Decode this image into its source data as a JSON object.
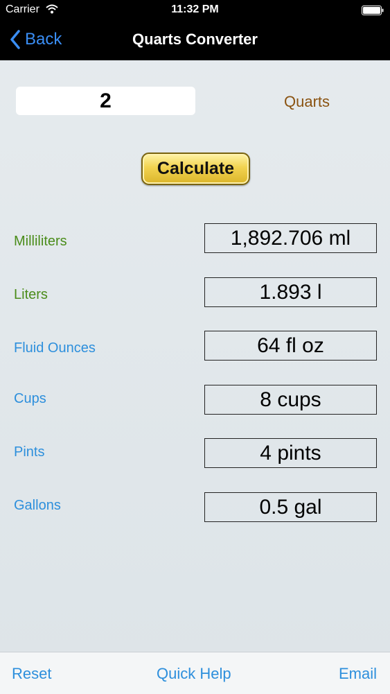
{
  "status_bar": {
    "carrier": "Carrier",
    "time": "11:32 PM"
  },
  "nav": {
    "back_label": "Back",
    "title": "Quarts Converter"
  },
  "input": {
    "value": "2",
    "unit": "Quarts"
  },
  "calculate_label": "Calculate",
  "results": [
    {
      "label": "Milliliters",
      "value": "1,892.706 ml"
    },
    {
      "label": "Liters",
      "value": "1.893 l"
    },
    {
      "label": "Fluid Ounces",
      "value": "64 fl oz"
    },
    {
      "label": "Cups",
      "value": "8 cups"
    },
    {
      "label": "Pints",
      "value": "4 pints"
    },
    {
      "label": "Gallons",
      "value": "0.5 gal"
    }
  ],
  "toolbar": {
    "reset": "Reset",
    "quick_help": "Quick Help",
    "email": "Email"
  },
  "colors": {
    "nav_background": "#000000",
    "back_blue": "#3a8ef5",
    "unit_brown": "#8a5311",
    "metric_green": "#4a8c1a",
    "us_blue": "#2d8fdc",
    "button_gold": "#f2d350"
  },
  "icons": [
    "wifi-icon",
    "battery-icon",
    "back-chevron-icon"
  ]
}
